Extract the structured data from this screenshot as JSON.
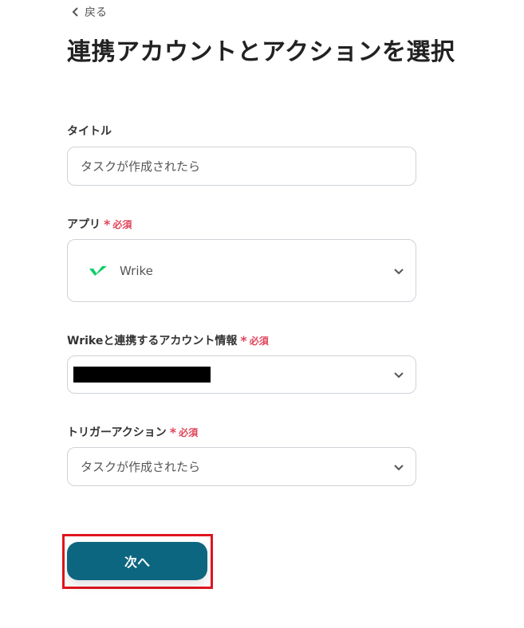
{
  "nav": {
    "back_label": "戻る"
  },
  "page": {
    "title": "連携アカウントとアクションを選択"
  },
  "form": {
    "title_field": {
      "label": "タイトル",
      "value": "タスクが作成されたら"
    },
    "app_field": {
      "label": "アプリ",
      "required_mark": "*",
      "required_text": "必須",
      "value": "Wrike",
      "icon": "wrike-logo-icon"
    },
    "account_field": {
      "label": "Wrikeと連携するアカウント情報",
      "required_mark": "*",
      "required_text": "必須"
    },
    "trigger_field": {
      "label": "トリガーアクション",
      "required_mark": "*",
      "required_text": "必須",
      "value": "タスクが作成されたら"
    }
  },
  "actions": {
    "next_label": "次へ"
  },
  "colors": {
    "accent": "#0c6680",
    "required": "#e0455a",
    "highlight_border": "#e0151e",
    "wrike_green": "#08cf65"
  }
}
